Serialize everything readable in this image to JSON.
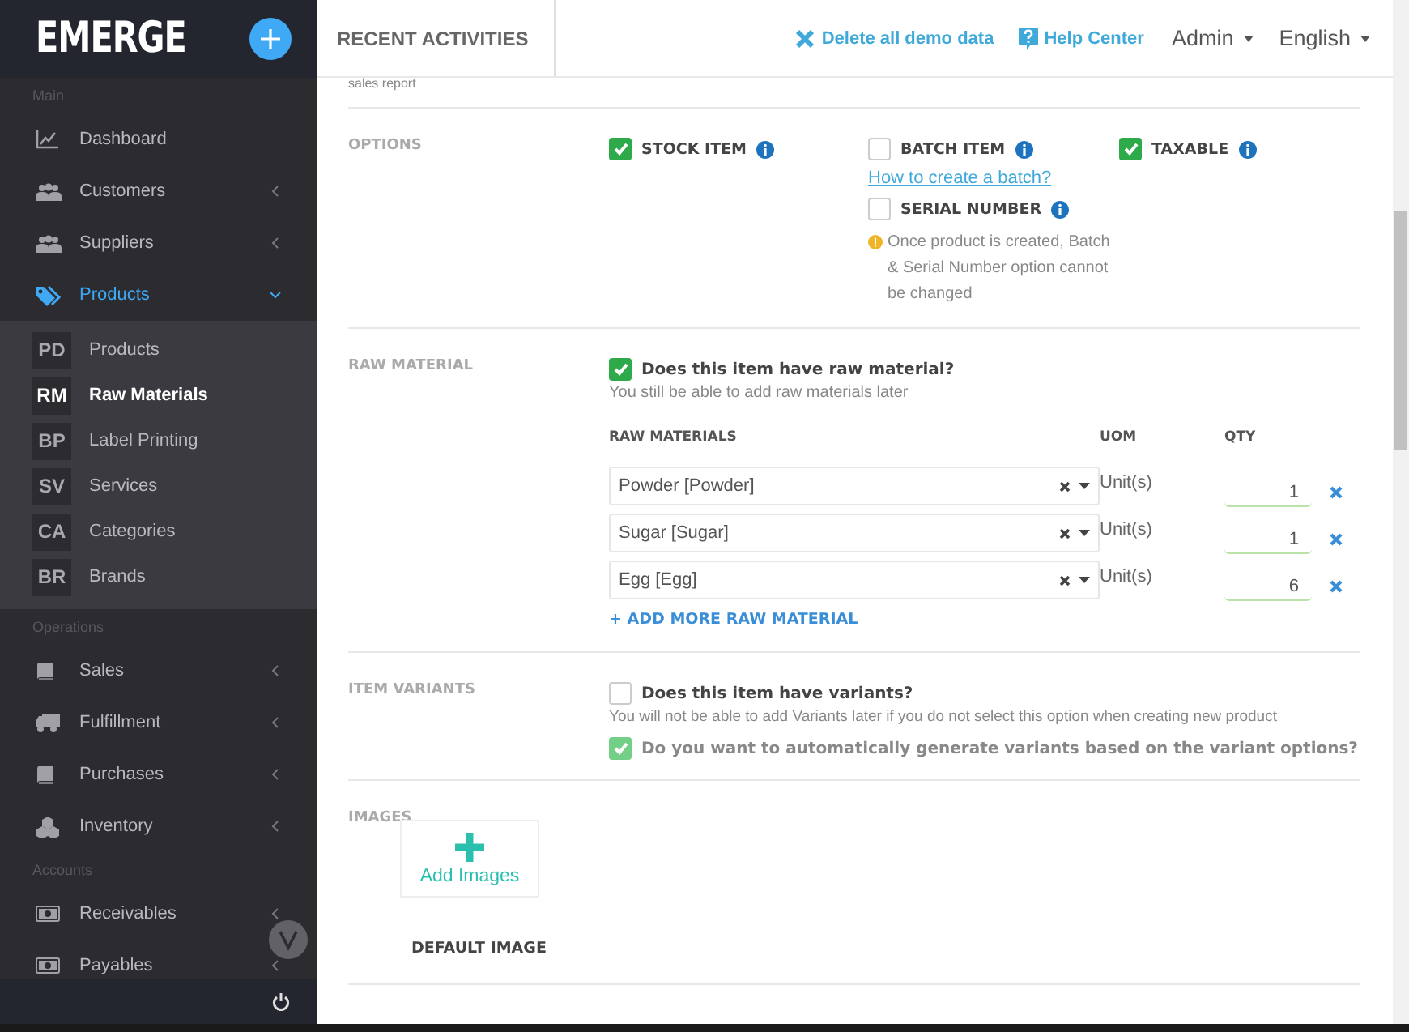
{
  "sidebar": {
    "logo": "EMERGE",
    "sections": [
      {
        "heading": "Main",
        "items": [
          {
            "label": "Dashboard",
            "expandable": false,
            "selected": false
          },
          {
            "label": "Customers",
            "expandable": true,
            "expanded": false,
            "selected": false
          },
          {
            "label": "Suppliers",
            "expandable": true,
            "expanded": false,
            "selected": false
          },
          {
            "label": "Products",
            "expandable": true,
            "expanded": true,
            "selected": true,
            "children": [
              {
                "abbr": "PD",
                "label": "Products",
                "selected": false
              },
              {
                "abbr": "RM",
                "label": "Raw Materials",
                "selected": true
              },
              {
                "abbr": "BP",
                "label": "Label Printing",
                "selected": false
              },
              {
                "abbr": "SV",
                "label": "Services",
                "selected": false
              },
              {
                "abbr": "CA",
                "label": "Categories",
                "selected": false
              },
              {
                "abbr": "BR",
                "label": "Brands",
                "selected": false
              }
            ]
          }
        ]
      },
      {
        "heading": "Operations",
        "items": [
          {
            "label": "Sales",
            "expandable": true,
            "expanded": false,
            "selected": false
          },
          {
            "label": "Fulfillment",
            "expandable": true,
            "expanded": false,
            "selected": false
          },
          {
            "label": "Purchases",
            "expandable": true,
            "expanded": false,
            "selected": false
          },
          {
            "label": "Inventory",
            "expandable": true,
            "expanded": false,
            "selected": false
          }
        ]
      },
      {
        "heading": "Accounts",
        "items": [
          {
            "label": "Receivables",
            "expandable": true,
            "expanded": false,
            "selected": false
          },
          {
            "label": "Payables",
            "expandable": true,
            "expanded": false,
            "selected": false
          }
        ]
      }
    ]
  },
  "header": {
    "title": "RECENT ACTIVITIES",
    "links": [
      "Delete all demo data",
      "Help Center"
    ],
    "menus": [
      "Admin",
      "English"
    ]
  },
  "form": {
    "cut_text": "sales report",
    "options": {
      "label": "OPTIONS",
      "columns": [
        [
          {
            "label": "STOCK ITEM",
            "checked": true
          }
        ],
        [
          {
            "label": "BATCH ITEM",
            "checked": false,
            "link": "How to create a batch?"
          },
          {
            "label": "SERIAL NUMBER",
            "checked": false,
            "note": "Once product is created, Batch & Serial Number option cannot be changed"
          }
        ],
        [
          {
            "label": "TAXABLE",
            "checked": true
          }
        ]
      ]
    },
    "raw_material": {
      "label": "RAW MATERIAL",
      "question": "Does this item have raw material?",
      "checked": true,
      "hint": "You still be able to add raw materials later",
      "columns": [
        "RAW MATERIALS",
        "UOM",
        "QTY"
      ],
      "rows": [
        {
          "material": "Powder [Powder]",
          "uom": "Unit(s)",
          "qty": "1"
        },
        {
          "material": "Sugar [Sugar]",
          "uom": "Unit(s)",
          "qty": "1"
        },
        {
          "material": "Egg [Egg]",
          "uom": "Unit(s)",
          "qty": "6"
        }
      ],
      "add_link": "+ ADD MORE RAW MATERIAL"
    },
    "variants": {
      "label": "ITEM VARIANTS",
      "question": "Does this item have variants?",
      "checked": false,
      "hint": "You will not be able to add Variants later if you do not select this option when creating new product",
      "auto": {
        "label": "Do you want to automatically generate variants based on the variant options?",
        "checked": true,
        "disabled": true
      }
    },
    "images": {
      "label": "IMAGES",
      "add_button": "Add Images",
      "default_label": "DEFAULT IMAGE"
    }
  }
}
